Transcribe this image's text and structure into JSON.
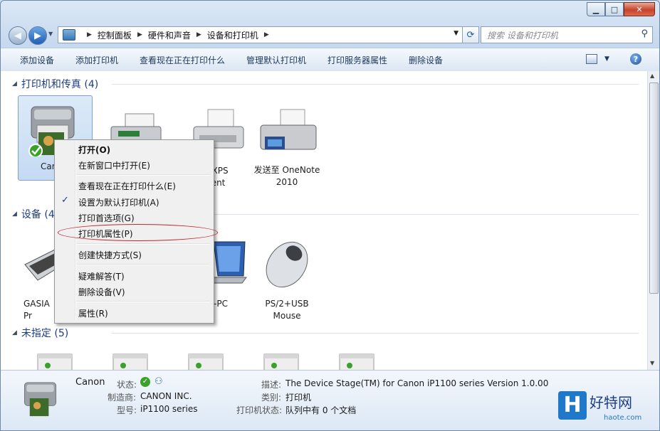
{
  "nav": {
    "breadcrumbs": [
      "控制面板",
      "硬件和声音",
      "设备和打印机"
    ],
    "search_placeholder": "搜索 设备和打印机"
  },
  "toolbar": {
    "items": [
      "添加设备",
      "添加打印机",
      "查看现在正在打印什么",
      "管理默认打印机",
      "打印服务器属性",
      "删除设备"
    ],
    "help": "?"
  },
  "groups": {
    "printers": {
      "title": "打印机和传真 (4)",
      "items": [
        {
          "label": "Can",
          "icon": "inkjet-printer-icon"
        },
        {
          "label": "",
          "icon": "fax-printer-icon"
        },
        {
          "label": "ft XPS\nment\ner",
          "icon": "xps-printer-icon"
        },
        {
          "label": "发送至 OneNote\n2010",
          "icon": "onenote-printer-icon"
        }
      ]
    },
    "devices": {
      "title": "设备 (4",
      "items": [
        {
          "label": "GASIA\nPr",
          "icon": "keyboard-icon"
        },
        {
          "label": "-PC",
          "icon": "laptop-icon"
        },
        {
          "label": "PS/2+USB\nMouse",
          "icon": "mouse-icon"
        }
      ]
    },
    "unspecified": {
      "title": "未指定 (5)",
      "count": 5
    }
  },
  "context_menu": {
    "items": [
      {
        "label": "打开(O)",
        "bold": true
      },
      {
        "label": "在新窗口中打开(E)"
      },
      {
        "label": "查看现在正在打印什么(E)"
      },
      {
        "label": "设置为默认打印机(A)",
        "checked": true
      },
      {
        "label": "打印首选项(G)"
      },
      {
        "label": "打印机属性(P)",
        "highlighted": true
      },
      {
        "label": "创建快捷方式(S)"
      },
      {
        "label": "疑难解答(T)"
      },
      {
        "label": "删除设备(V)"
      },
      {
        "label": "属性(R)"
      }
    ],
    "check_glyph": "✓"
  },
  "details": {
    "name": "Canon",
    "status_label": "状态:",
    "manufacturer_label": "制造商:",
    "manufacturer": "CANON INC.",
    "model_label": "型号:",
    "model": "iP1100 series",
    "description_label": "描述:",
    "description": "The Device Stage(TM) for Canon iP1100 series Version 1.0.00",
    "category_label": "类别:",
    "category": "打印机",
    "printer_status_label": "打印机状态:",
    "printer_status": "队列中有 0 个文档"
  },
  "watermark": {
    "brand": "好特网",
    "letter": "H",
    "site": "haote.com"
  },
  "colors": {
    "accent": "#1e3d82",
    "menu_highlight_ellipse": "#c0282c",
    "check_ok": "#3aa12a"
  }
}
